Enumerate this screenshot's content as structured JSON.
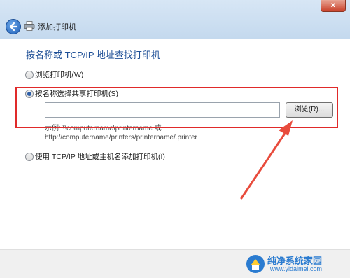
{
  "window": {
    "title": "添加打印机",
    "close_label": "x"
  },
  "heading": "按名称或 TCP/IP 地址查找打印机",
  "options": [
    {
      "label": "浏览打印机(W)",
      "checked": false
    },
    {
      "label": "按名称选择共享打印机(S)",
      "checked": true
    },
    {
      "label": "使用 TCP/IP 地址或主机名添加打印机(I)",
      "checked": false
    }
  ],
  "share_input": {
    "value": "",
    "placeholder": ""
  },
  "browse_button": "浏览(R)...",
  "example_line1": "示例: \\\\computername\\printername 或",
  "example_line2": "http://computername/printers/printername/.printer",
  "watermark": {
    "text": "纯净系统家园",
    "url": "www.yidaimei.com"
  },
  "colors": {
    "annotation": "#e02a2a",
    "heading": "#1e4f96"
  }
}
